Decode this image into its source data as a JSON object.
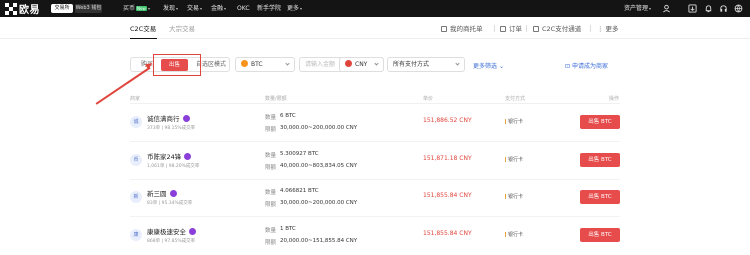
{
  "nav": {
    "logo_text": "欧易",
    "exchange_pill": "交易所",
    "web3_pill": "Web3 钱包",
    "items": [
      {
        "label": "买币",
        "badge": "New"
      },
      {
        "label": "发现"
      },
      {
        "label": "交易"
      },
      {
        "label": "金融"
      },
      {
        "label": "OKC"
      },
      {
        "label": "新手学院"
      },
      {
        "label": "更多"
      }
    ],
    "asset_mgmt": "资产管理"
  },
  "subnav": {
    "tabs": [
      "C2C交易",
      "大宗交易"
    ],
    "links": [
      "我的商托单",
      "订单",
      "C2C支付通道",
      "更多"
    ]
  },
  "filters": {
    "buy_label": "购买",
    "sell_label": "出售",
    "mode_label": "自选区模式",
    "coin": "BTC",
    "amount_placeholder": "请输入金额",
    "currency": "CNY",
    "payment": "所有支付方式",
    "more_filter": "更多筛选",
    "apply_merchant": "申请成为商家"
  },
  "table": {
    "headers": [
      "商家",
      "数量/限额",
      "单价",
      "支付方式",
      "操作"
    ],
    "qty_label": "数量",
    "limit_label": "限额",
    "rows": [
      {
        "avatar": "诚",
        "name": "诚信满商行",
        "stats": "373单 | 98.15%成交率",
        "qty": "6 BTC",
        "limit": "30,000.00~200,000.00 CNY",
        "price": "151,886.52 CNY",
        "pay": "银行卡",
        "action": "出售 BTC"
      },
      {
        "avatar": "币",
        "name": "币陈家24锋",
        "stats": "1,061单 | 98.20%成交率",
        "qty": "5.300927 BTC",
        "limit": "40,000.00~803,834.05 CNY",
        "price": "151,871.18 CNY",
        "pay": "银行卡",
        "action": "出售 BTC"
      },
      {
        "avatar": "新",
        "name": "新三圆",
        "stats": "83单 | 95.34%成交率",
        "qty": "4.066821 BTC",
        "limit": "30,000.00~200,000.00 CNY",
        "price": "151,855.84 CNY",
        "pay": "银行卡",
        "action": "出售 BTC"
      },
      {
        "avatar": "康",
        "name": "康康极速安全",
        "stats": "868单 | 97.85%成交率",
        "qty": "1 BTC",
        "limit": "20,000.00~151,855.84 CNY",
        "price": "151,855.84 CNY",
        "pay": "银行卡",
        "action": "出售 BTC"
      }
    ]
  },
  "colors": {
    "accent": "#e64c4c",
    "link": "#3b6ed8",
    "nav_bg": "#141414"
  }
}
